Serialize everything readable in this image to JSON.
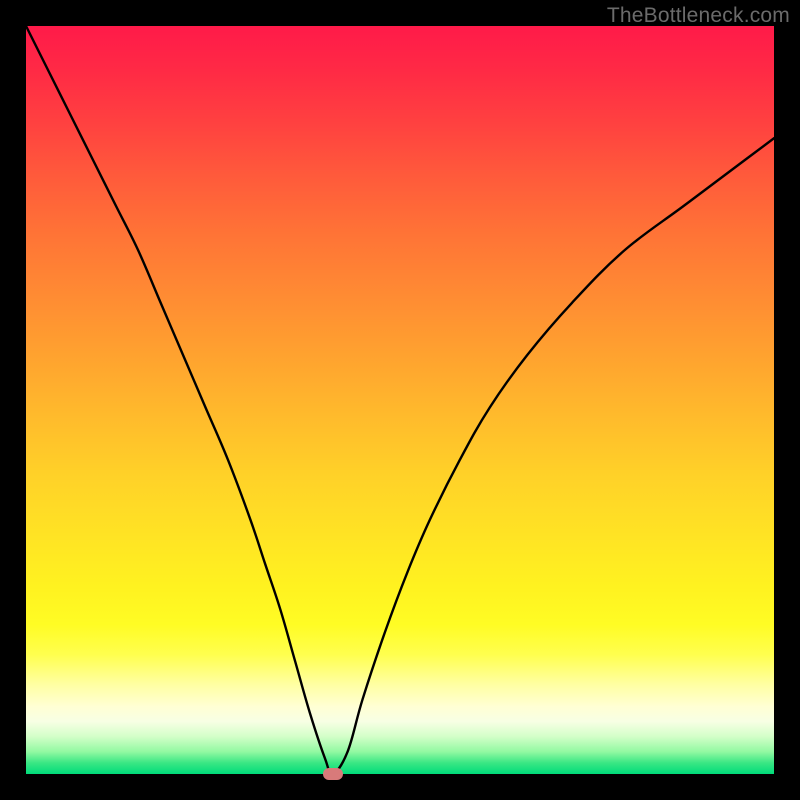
{
  "watermark": "TheBottleneck.com",
  "chart_data": {
    "type": "line",
    "title": "",
    "xlabel": "",
    "ylabel": "",
    "xlim": [
      0,
      100
    ],
    "ylim": [
      0,
      100
    ],
    "grid": false,
    "series": [
      {
        "name": "bottleneck-curve",
        "x": [
          0,
          3,
          6,
          9,
          12,
          15,
          18,
          21,
          24,
          27,
          30,
          32,
          34,
          36,
          38,
          40,
          41,
          43,
          45,
          48,
          51,
          54,
          58,
          62,
          67,
          73,
          80,
          88,
          96,
          100
        ],
        "values": [
          100,
          94,
          88,
          82,
          76,
          70,
          63,
          56,
          49,
          42,
          34,
          28,
          22,
          15,
          8,
          2,
          0,
          3,
          10,
          19,
          27,
          34,
          42,
          49,
          56,
          63,
          70,
          76,
          82,
          85
        ]
      }
    ],
    "marker": {
      "x": 41,
      "y": 0
    },
    "background_gradient": {
      "top": "#ff1a49",
      "mid": "#ffe324",
      "bottom": "#00db7a"
    }
  }
}
